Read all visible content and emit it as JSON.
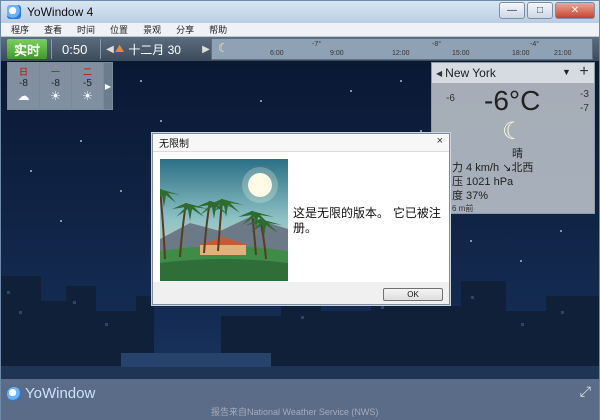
{
  "window": {
    "title": "YoWindow 4",
    "min": "—",
    "max": "□",
    "close": "✕"
  },
  "menu": [
    "程序",
    "查看",
    "时间",
    "位置",
    "景观",
    "分享",
    "帮助"
  ],
  "toolbar": {
    "now_label": "实时",
    "time": "0:50",
    "date": "十二月 30",
    "timeline_marks": [
      "6:00",
      "-7°",
      "9:00",
      "12:00",
      "-8°",
      "15:00",
      "18:00",
      "-4°",
      "21:00"
    ]
  },
  "forecast": [
    {
      "name": "日",
      "temp": "-8",
      "icon": "cloud-moon-icon"
    },
    {
      "name": "一",
      "temp": "-8",
      "icon": "sun-icon"
    },
    {
      "name": "二",
      "temp": "-5",
      "icon": "sun-icon"
    }
  ],
  "city": {
    "name": "New York",
    "temp": "-6°C",
    "left_temp": "-6",
    "right_nums": [
      "-3",
      "-7"
    ],
    "condition": "晴",
    "wind": "力  4 km/h ↘北西",
    "pressure": "压  1021 hPa",
    "humidity": "度  37%",
    "updated": "6 m前"
  },
  "dialog": {
    "title": "无限制",
    "close": "×",
    "message": "这是无限的版本。 它已被注册。",
    "ok": "OK"
  },
  "brand": "YoWindow",
  "source_note": "报告来自National Weather Service (NWS)",
  "colors": {
    "now_green": "#4caf35",
    "sky": "#0b1a33"
  }
}
